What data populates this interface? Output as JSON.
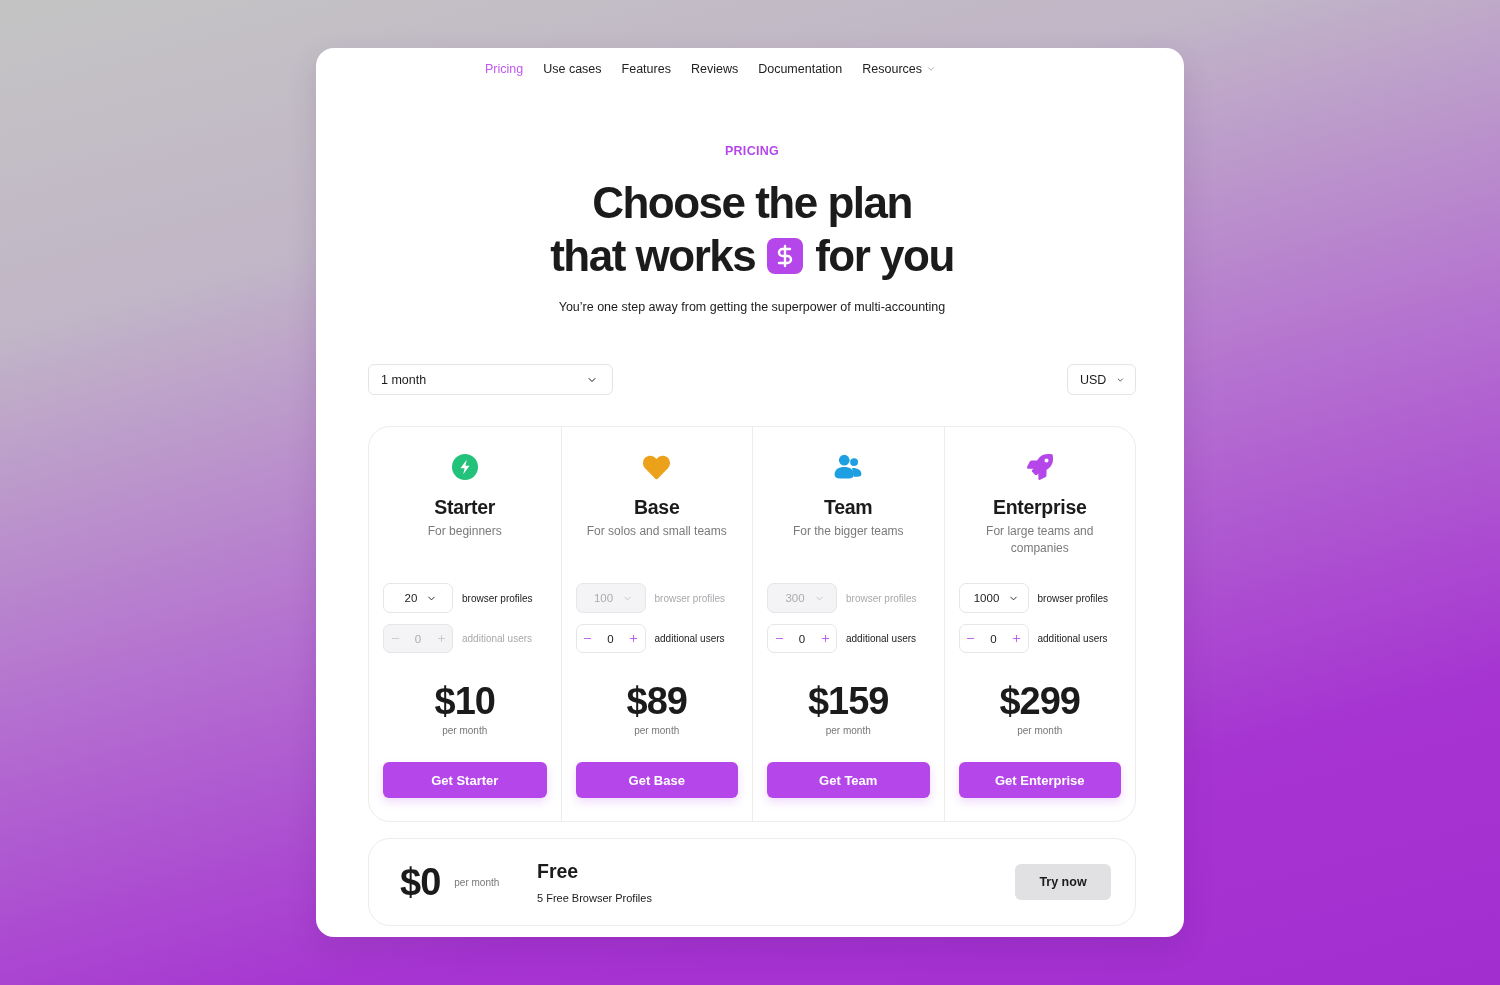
{
  "nav": {
    "items": [
      {
        "label": "Pricing",
        "selected": true,
        "kind": "link"
      },
      {
        "label": "Use cases",
        "selected": false,
        "kind": "link"
      },
      {
        "label": "Features",
        "selected": false,
        "kind": "link"
      },
      {
        "label": "Reviews",
        "selected": false,
        "kind": "link"
      },
      {
        "label": "Documentation",
        "selected": false,
        "kind": "link"
      },
      {
        "label": "Resources",
        "selected": false,
        "kind": "menu"
      }
    ]
  },
  "hero": {
    "eyebrow": "PRICING",
    "title": {
      "line_1": "Choose the plan",
      "line_2_start": "that works",
      "line_2_end": "for you"
    },
    "subtitle": "You’re one step away from getting the superpower of multi-accounting"
  },
  "filters": {
    "period": "1 month",
    "currency": "USD"
  },
  "plans": [
    {
      "name": "Starter",
      "tagline": "For beginners",
      "profiles": {
        "value": "20",
        "label": "browser profiles",
        "disabled": false
      },
      "users": {
        "value": "0",
        "label": "additional users",
        "disabled": true
      },
      "price": "$10",
      "period": "per month",
      "cta": "Get Starter"
    },
    {
      "name": "Base",
      "tagline": "For solos and small teams",
      "profiles": {
        "value": "100",
        "label": "browser profiles",
        "disabled": true
      },
      "users": {
        "value": "0",
        "label": "additional users",
        "disabled": false
      },
      "price": "$89",
      "period": "per month",
      "cta": "Get Base"
    },
    {
      "name": "Team",
      "tagline": "For the bigger teams",
      "profiles": {
        "value": "300",
        "label": "browser profiles",
        "disabled": true
      },
      "users": {
        "value": "0",
        "label": "additional users",
        "disabled": false
      },
      "price": "$159",
      "period": "per month",
      "cta": "Get Team"
    },
    {
      "name": "Enterprise",
      "tagline": "For large teams and companies",
      "profiles": {
        "value": "1000",
        "label": "browser profiles",
        "disabled": false
      },
      "users": {
        "value": "0",
        "label": "additional users",
        "disabled": false
      },
      "price": "$299",
      "period": "per month",
      "cta": "Get Enterprise"
    }
  ],
  "free": {
    "price": "$0",
    "period": "per month",
    "name": "Free",
    "detail": "5 Free Browser Profiles",
    "cta": "Try now"
  }
}
